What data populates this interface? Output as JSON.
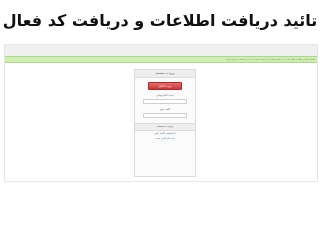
{
  "slide": {
    "title": "تائید دریافت اطلاعات و دریافت کد فعال سازی"
  },
  "screenshot": {
    "notice_text": "مشترک گرامی لطفا کد فعال سازی را از طریق ایمیل ارسال شده دریافت کرده و در قسمت زیر وارد نمایید",
    "panel": {
      "header": "ورود به سیستم",
      "primary_button": "ورود با گوگل",
      "field1_label": "پست الکترونیکی",
      "field2_label": "کلمه عبور",
      "section_header": "ورود به سیستم",
      "links": [
        "فراموشی کلمه عبور",
        "ثبت نام کاربر جدید"
      ]
    }
  },
  "colors": {
    "notice_bg": "#cfeeb3",
    "button_red": "#c83838"
  }
}
